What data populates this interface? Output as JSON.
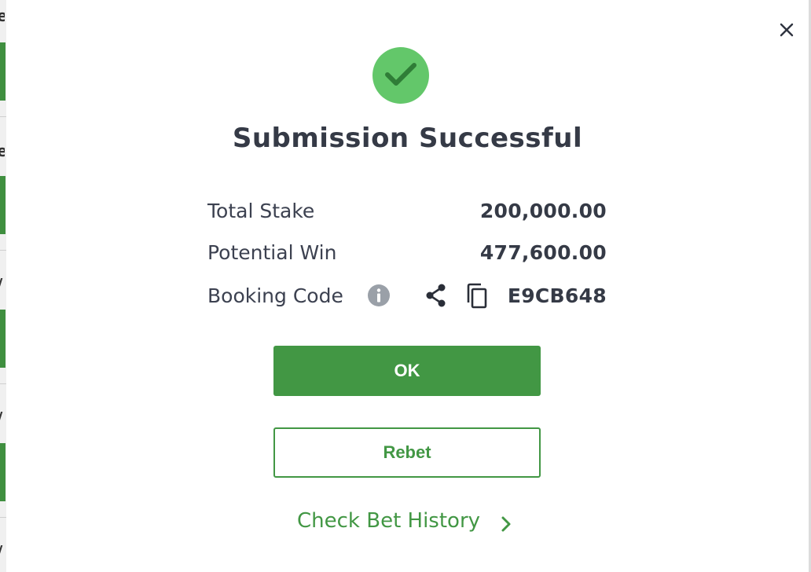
{
  "background": {
    "edge_letters": [
      "e",
      "e",
      "/",
      "/",
      "/"
    ]
  },
  "modal": {
    "close_icon": "close-icon",
    "status_icon": "check-circle-icon",
    "title": "Submission Successful",
    "rows": {
      "total_stake": {
        "label": "Total Stake",
        "value": "200,000.00"
      },
      "potential_win": {
        "label": "Potential Win",
        "value": "477,600.00"
      },
      "booking_code": {
        "label": "Booking Code",
        "value": "E9CB648"
      }
    },
    "icons": {
      "info": "info-icon",
      "share": "share-icon",
      "copy": "copy-icon"
    },
    "buttons": {
      "ok": "OK",
      "rebet": "Rebet"
    },
    "link": {
      "check_bet_history": "Check Bet History"
    }
  },
  "colors": {
    "brand_green": "#429744",
    "success_green": "#63c76a",
    "text_dark": "#353a46",
    "icon_gray": "#9aa0a8"
  }
}
